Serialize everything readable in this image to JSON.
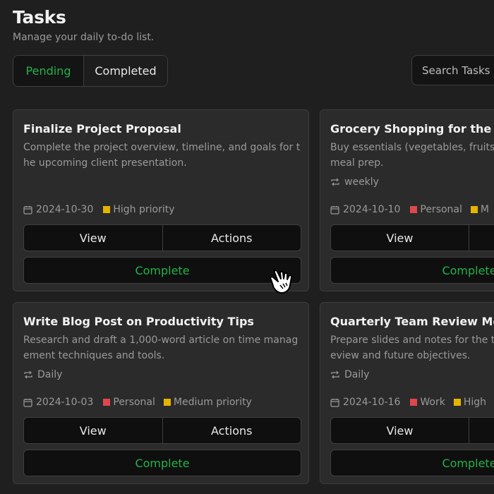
{
  "header": {
    "title": "Tasks",
    "subtitle": "Manage your daily to-do list."
  },
  "tabs": [
    {
      "label": "Pending",
      "active": true
    },
    {
      "label": "Completed",
      "active": false
    }
  ],
  "search": {
    "placeholder": "Search Tasks"
  },
  "colors": {
    "accent_green": "#22b34a",
    "priority_yellow": "#e6b400",
    "tag_red": "#e0474c"
  },
  "cards": [
    {
      "title": "Finalize Project Proposal",
      "description": "Complete the project overview, timeline, and goals for the upcoming client presentation.",
      "recurrence": "",
      "date": "2024-10-30",
      "tags": [
        {
          "label": "High priority",
          "color": "#e6b400"
        }
      ],
      "view_label": "View",
      "actions_label": "Actions",
      "complete_label": "Complete"
    },
    {
      "title": "Grocery Shopping for the We",
      "description": "Buy essentials (vegetables, fruits, d meal prep.",
      "recurrence": "weekly",
      "date": "2024-10-10",
      "tags": [
        {
          "label": "Personal",
          "color": "#e0474c"
        },
        {
          "label": "M",
          "color": "#e6b400"
        }
      ],
      "view_label": "View",
      "actions_label": "",
      "complete_label": "Complete"
    },
    {
      "title": "Write Blog Post on Productivity Tips",
      "description": "Research and draft a 1,000-word article on time management techniques and tools.",
      "recurrence": "Daily",
      "date": "2024-10-03",
      "tags": [
        {
          "label": "Personal",
          "color": "#e0474c"
        },
        {
          "label": "Medium priority",
          "color": "#e6b400"
        }
      ],
      "view_label": "View",
      "actions_label": "Actions",
      "complete_label": "Complete"
    },
    {
      "title": "Quarterly Team Review Meet",
      "description": "Prepare slides and notes for the tea eview and future objectives.",
      "recurrence": "Daily",
      "date": "2024-10-16",
      "tags": [
        {
          "label": "Work",
          "color": "#e0474c"
        },
        {
          "label": "High",
          "color": "#e6b400"
        }
      ],
      "view_label": "View",
      "actions_label": "",
      "complete_label": "Complete"
    }
  ]
}
